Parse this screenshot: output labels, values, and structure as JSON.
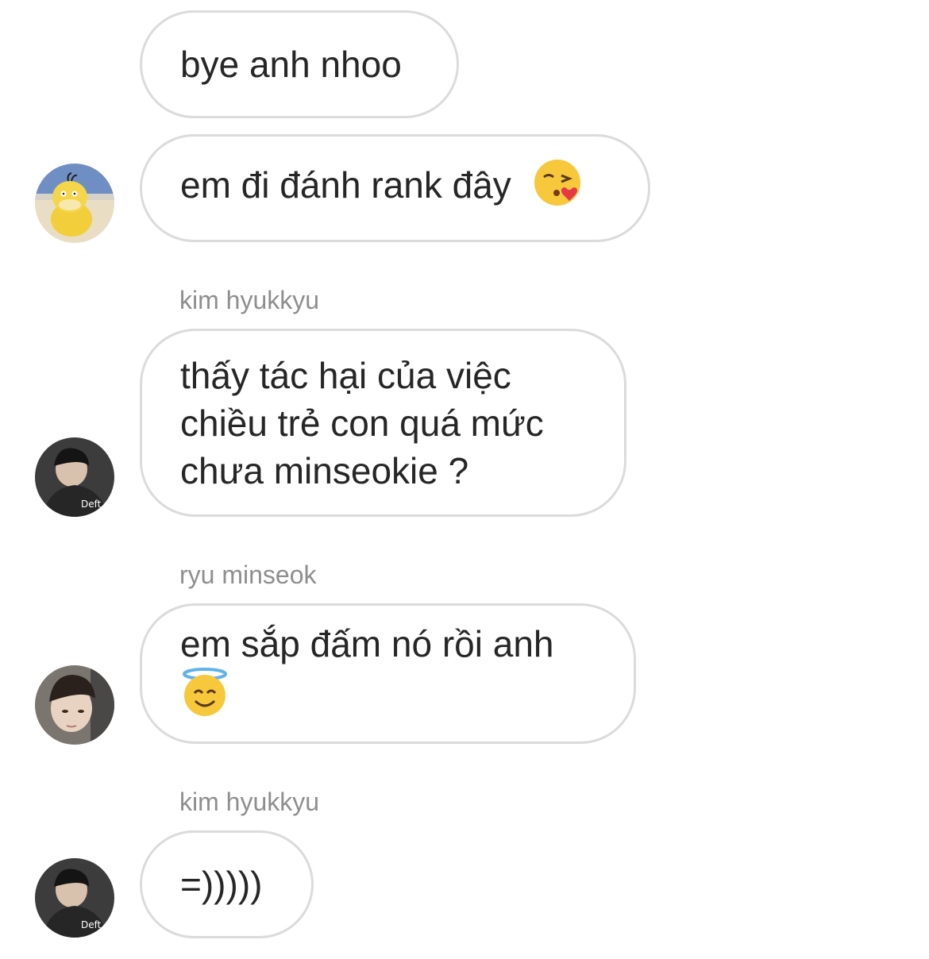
{
  "messages": [
    {
      "lines": [
        "bye anh nhoo"
      ]
    },
    {
      "lines": [
        "em đi đánh rank đây"
      ],
      "emoji": "face-blowing-kiss-emoji"
    },
    {
      "sender": "kim hyukkyu",
      "lines": [
        "thấy tác hại của việc",
        "chiều trẻ con quá mức",
        "chưa minseokie ?"
      ]
    },
    {
      "sender": "ryu minseok",
      "lines": [
        "em sắp đấm nó rồi anh"
      ],
      "emoji": "smiling-face-with-halo-emoji"
    },
    {
      "sender": "kim hyukkyu",
      "lines": [
        "=)))))"
      ]
    }
  ],
  "avatars": {
    "psyduck": {
      "icon": "psyduck-avatar"
    },
    "kim_hyukkyu": {
      "icon": "user-avatar",
      "caption": "Deft"
    },
    "ryu_minseok": {
      "icon": "user-avatar"
    }
  }
}
